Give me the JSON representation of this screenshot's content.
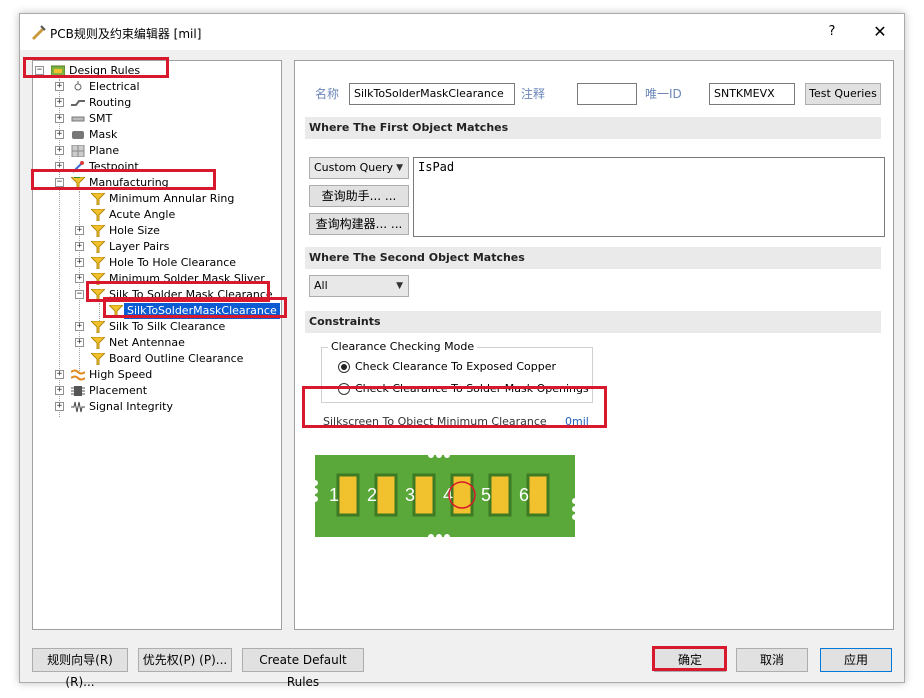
{
  "window": {
    "title": "PCB规则及约束编辑器 [mil]",
    "help": "?",
    "close": "✕"
  },
  "tree": {
    "root": "Design Rules",
    "items": [
      {
        "label": "Electrical"
      },
      {
        "label": "Routing"
      },
      {
        "label": "SMT"
      },
      {
        "label": "Mask"
      },
      {
        "label": "Plane"
      },
      {
        "label": "Testpoint"
      },
      {
        "label": "Manufacturing"
      },
      {
        "label": "Minimum Annular Ring"
      },
      {
        "label": "Acute Angle"
      },
      {
        "label": "Hole Size"
      },
      {
        "label": "Layer Pairs"
      },
      {
        "label": "Hole To Hole Clearance"
      },
      {
        "label": "Minimum Solder Mask Sliver"
      },
      {
        "label": "Silk To Solder Mask Clearance"
      },
      {
        "label": "SilkToSolderMaskClearance"
      },
      {
        "label": "Silk To Silk Clearance"
      },
      {
        "label": "Net Antennae"
      },
      {
        "label": "Board Outline Clearance"
      },
      {
        "label": "High Speed"
      },
      {
        "label": "Placement"
      },
      {
        "label": "Signal Integrity"
      }
    ]
  },
  "rule": {
    "name_label": "名称",
    "name_value": "SilkToSolderMaskClearance",
    "comment_label": "注释",
    "comment_value": "",
    "uid_label": "唯一ID",
    "uid_value": "SNTKMEVX",
    "test_queries": "Test Queries"
  },
  "first_match": {
    "header": "Where The First Object Matches",
    "query_type": "Custom Query",
    "query_helper": "查询助手... ...",
    "query_builder": "查询构建器... ...",
    "query_text": "IsPad"
  },
  "second_match": {
    "header": "Where The Second Object Matches",
    "query_type": "All"
  },
  "constraints": {
    "header": "Constraints",
    "mode_title": "Clearance Checking Mode",
    "option1": "Check Clearance To Exposed Copper",
    "option2": "Check Clearance To Solder Mask Openings",
    "selected_option": 1,
    "min_clearance_label": "Silkscreen To Object Minimum Clearance",
    "min_clearance_value": "0mil",
    "pad_numbers": [
      "1",
      "2",
      "3",
      "4",
      "5",
      "6"
    ]
  },
  "footer": {
    "rule_wizard": "规则向导(R) (R)...",
    "priority": "优先权(P) (P)...",
    "create_default": "Create Default Rules",
    "ok": "确定",
    "cancel": "取消",
    "apply": "应用"
  },
  "colors": {
    "highlight": "#d8182c",
    "selection": "#0b5bd3",
    "pcb_green": "#5aa83a",
    "pad_yellow": "#f2c12e",
    "value_blue": "#1f5fbf"
  }
}
